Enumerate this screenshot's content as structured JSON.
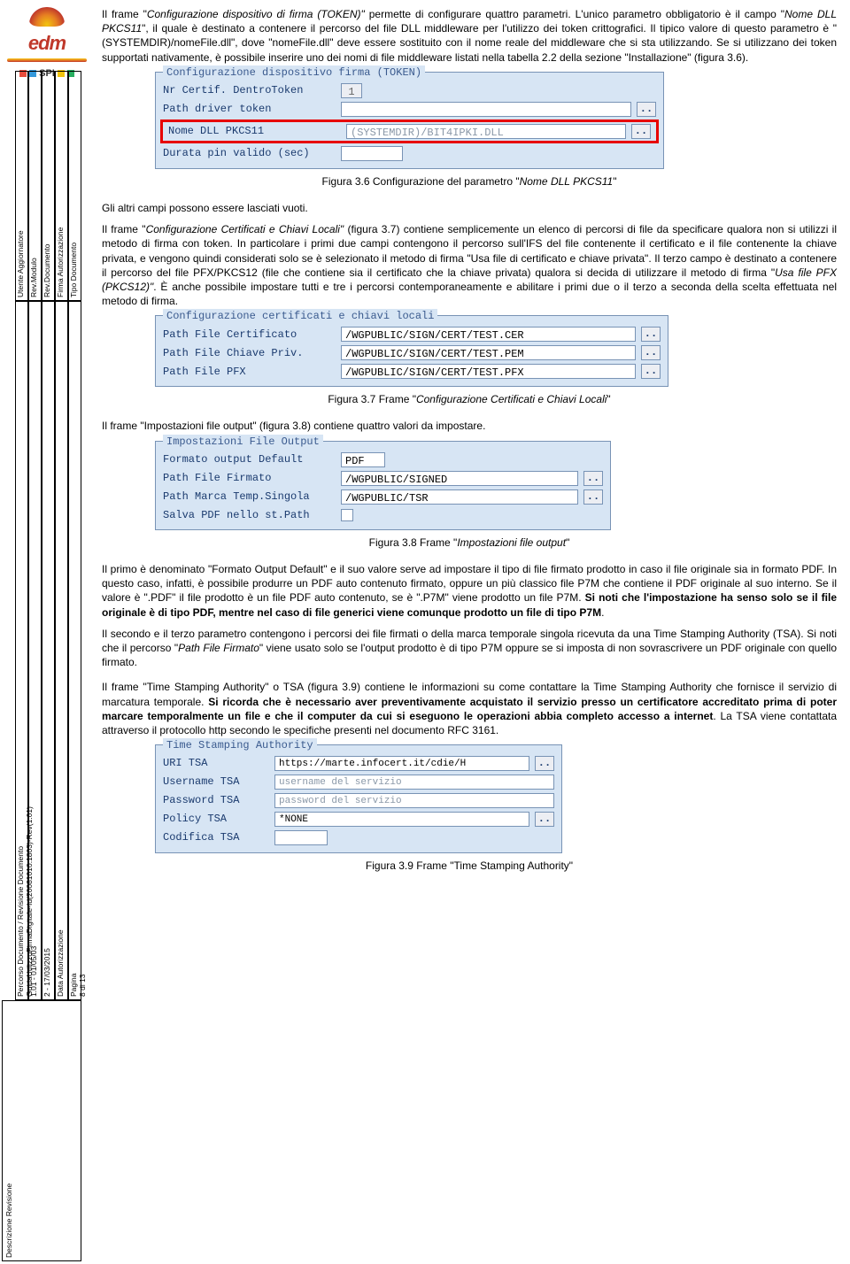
{
  "sidebar": {
    "logo_text": "edm",
    "spi_text": "SPI",
    "row1": {
      "c1": "Tipo Documento",
      "c2": "Firma Autorizzazione",
      "c3": "Rev.Documento",
      "c4": "Rev.Modulo",
      "c5": "Utente Aggiornatore"
    },
    "row2": {
      "c1": "Pagina",
      "c1v": "8 di 13",
      "c2": "Data Autorizzazione",
      "c3": "2 - 17/03/2015",
      "c4": "1.01 - 01/05/03",
      "c5": "Percorso Documento / Revisione Documento",
      "c5v": "GuidaUtilizzoFirmaDigitale-Id(20081010.1803)-Rev(1.01)"
    },
    "row3": {
      "c1": "Descrizione Revisione"
    }
  },
  "p1a": "Il frame \"",
  "p1b": "Configurazione dispositivo di firma (TOKEN)\"",
  "p1c": " permette di configurare quattro parametri. L'unico parametro obbligatorio è il campo \"",
  "p1d": "Nome DLL PKCS11",
  "p1e": "\", il quale è destinato a contenere il percorso del file DLL middleware per l'utilizzo dei token crittografici. Il tipico valore di questo parametro è \"(SYSTEMDIR)/nomeFile.dll\", dove \"nomeFile.dll\" deve essere sostituito con il nome reale del middleware che si sta utilizzando. Se si utilizzano dei token supportati nativamente, è possibile inserire uno dei nomi di file middleware listati nella tabella 2.2 della sezione \"Installazione\" (figura 3.6).",
  "fig36": {
    "legend": "Configurazione dispositivo firma (TOKEN)",
    "r1l": "Nr Certif. DentroToken",
    "r1v": "1",
    "r2l": "Path driver token",
    "r3l": "Nome DLL PKCS11",
    "r3v": "(SYSTEMDIR)/BIT4IPKI.DLL",
    "r4l": "Durata pin valido (sec)",
    "btn": ".."
  },
  "cap36a": "Figura 3.6 Configurazione del parametro \"",
  "cap36b": "Nome DLL PKCS11",
  "cap36c": "\"",
  "p2": "Gli altri campi possono essere lasciati vuoti.",
  "p3a": "Il frame \"",
  "p3b": "Configurazione Certificati e Chiavi Locali\"",
  "p3c": " (figura 3.7) contiene semplicemente un elenco di percorsi di file da specificare qualora non si utilizzi il metodo di firma con token. In particolare i primi due campi contengono il percorso sull'IFS del file contenente il certificato e il file contenente la chiave privata, e vengono quindi considerati solo se è selezionato il metodo di firma \"Usa file di certificato e chiave privata\". Il terzo campo è destinato a contenere il percorso del file PFX/PKCS12 (file che contiene sia il certificato che la chiave privata) qualora si decida di utilizzare il metodo di firma \"",
  "p3d": "Usa file PFX (PKCS12)\"",
  "p3e": ". È anche possibile impostare tutti e tre i percorsi contemporaneamente e abilitare i primi due o il terzo a seconda della scelta effettuata nel metodo di firma.",
  "fig37": {
    "legend": "Configurazione certificati e chiavi locali",
    "r1l": "Path File Certificato",
    "r1v": "/WGPUBLIC/SIGN/CERT/TEST.CER",
    "r2l": "Path File Chiave Priv.",
    "r2v": "/WGPUBLIC/SIGN/CERT/TEST.PEM",
    "r3l": "Path File PFX",
    "r3v": "/WGPUBLIC/SIGN/CERT/TEST.PFX",
    "btn": ".."
  },
  "cap37a": "Figura 3.7 Frame \"",
  "cap37b": "Configurazione Certificati e Chiavi Locali",
  "cap37c": "\"",
  "p4": "Il frame \"Impostazioni file output\" (figura 3.8) contiene quattro valori da impostare.",
  "fig38": {
    "legend": "Impostazioni File Output",
    "r1l": "Formato output Default",
    "r1v": "PDF",
    "r2l": "Path File Firmato",
    "r2v": "/WGPUBLIC/SIGNED",
    "r3l": "Path Marca Temp.Singola",
    "r3v": "/WGPUBLIC/TSR",
    "r4l": "Salva PDF nello st.Path",
    "btn": ".."
  },
  "cap38a": "Figura 3.8 Frame \"",
  "cap38b": "Impostazioni file output",
  "cap38c": "\"",
  "p5a": "Il primo è denominato \"Formato Output Default\" e il suo valore serve ad impostare il tipo di file firmato prodotto in caso il file originale sia in formato PDF. In questo caso, infatti, è possibile produrre un PDF auto contenuto firmato, oppure un più classico file P7M che contiene il PDF originale al suo interno. Se il valore è \".PDF\" il file prodotto è un file PDF auto contenuto, se è \".P7M\" viene prodotto un file P7M. ",
  "p5b": "Si noti che l'impostazione ha senso solo se il file originale è di tipo PDF, mentre nel caso di file generici viene comunque prodotto un file di tipo P7M",
  "p5c": ".",
  "p6a": "Il secondo e il terzo parametro contengono i percorsi dei file firmati o della marca temporale singola ricevuta da una Time Stamping Authority (TSA). Si noti che il percorso \"",
  "p6b": "Path File Firmato",
  "p6c": "\" viene usato solo se l'output prodotto è di tipo P7M oppure se si imposta di non sovrascrivere un PDF originale con quello firmato.",
  "p7a": "Il frame \"Time Stamping Authority\" o TSA (figura 3.9) contiene le informazioni su come contattare la Time Stamping Authority che fornisce il servizio di marcatura temporale. ",
  "p7b": "Si ricorda che è necessario aver preventivamente acquistato il servizio presso un certificatore accreditato prima di poter marcare temporalmente un file e che il computer da cui si eseguono le operazioni abbia completo accesso a internet",
  "p7c": ". La TSA viene contattata attraverso il protocollo http secondo le specifiche presenti nel documento RFC 3161.",
  "fig39": {
    "legend": "Time Stamping Authority",
    "r1l": "URI     TSA",
    "r1v": "https://marte.infocert.it/cdie/H",
    "r2l": "Username TSA",
    "r2v": "username del servizio",
    "r3l": "Password TSA",
    "r3v": "password del servizio",
    "r4l": "Policy   TSA",
    "r4v": "*NONE",
    "r5l": "Codifica TSA",
    "btn": ".."
  },
  "cap39": "Figura 3.9 Frame \"Time Stamping Authority\""
}
